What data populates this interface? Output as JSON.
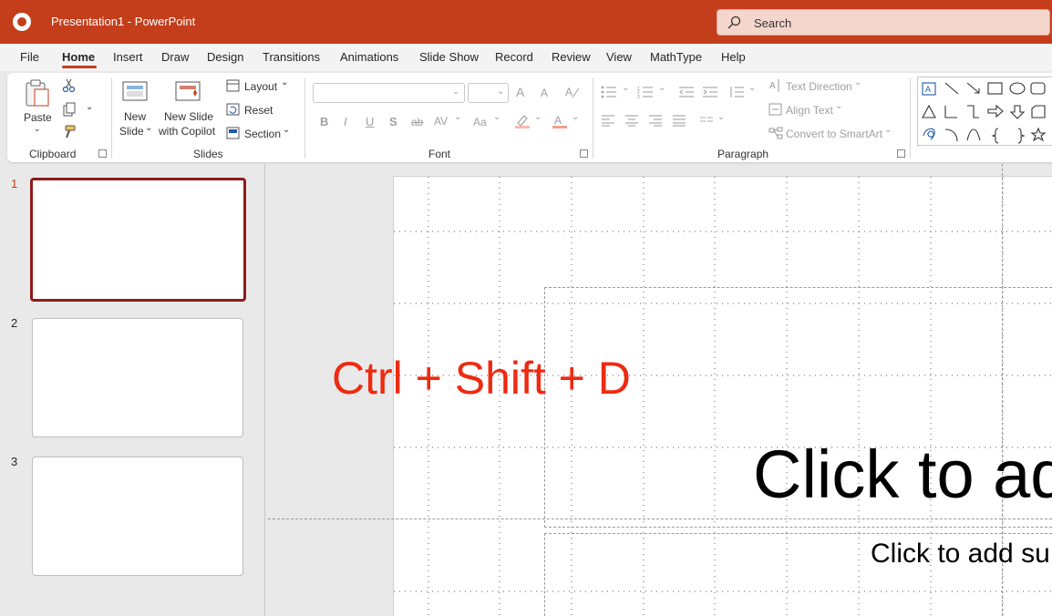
{
  "titlebar": {
    "doc_title": "Presentation1  -  PowerPoint",
    "search_placeholder": "Search",
    "background_color": "#c43e1c"
  },
  "menu": {
    "tabs": [
      {
        "label": "File"
      },
      {
        "label": "Home",
        "active": true
      },
      {
        "label": "Insert"
      },
      {
        "label": "Draw"
      },
      {
        "label": "Design"
      },
      {
        "label": "Transitions"
      },
      {
        "label": "Animations"
      },
      {
        "label": "Slide Show"
      },
      {
        "label": "Record"
      },
      {
        "label": "Review"
      },
      {
        "label": "View"
      },
      {
        "label": "MathType"
      },
      {
        "label": "Help"
      }
    ]
  },
  "ribbon": {
    "clipboard": {
      "paste": "Paste",
      "group_label": "Clipboard"
    },
    "slides": {
      "new_slide_line1": "New",
      "new_slide_line2": "Slide",
      "new_slide_copilot_line1": "New Slide",
      "new_slide_copilot_line2": "with Copilot",
      "layout": "Layout",
      "reset": "Reset",
      "section": "Section",
      "group_label": "Slides"
    },
    "font": {
      "bold": "B",
      "italic": "I",
      "underline": "U",
      "shadow": "S",
      "strike": "ab",
      "spacing": "AV",
      "case": "Aa",
      "grow": "A",
      "shrink": "A",
      "group_label": "Font"
    },
    "paragraph": {
      "text_direction": "Text Direction",
      "align_text": "Align Text",
      "convert_smartart": "Convert to SmartArt",
      "group_label": "Paragraph"
    }
  },
  "thumbnails": [
    {
      "number": "1",
      "selected": true
    },
    {
      "number": "2",
      "selected": false
    },
    {
      "number": "3",
      "selected": false
    }
  ],
  "slide": {
    "title_placeholder": "Click to ad",
    "subtitle_placeholder": "Click to add su",
    "overlay_text": "Ctrl + Shift + D",
    "overlay_color": "#ee2a10"
  }
}
